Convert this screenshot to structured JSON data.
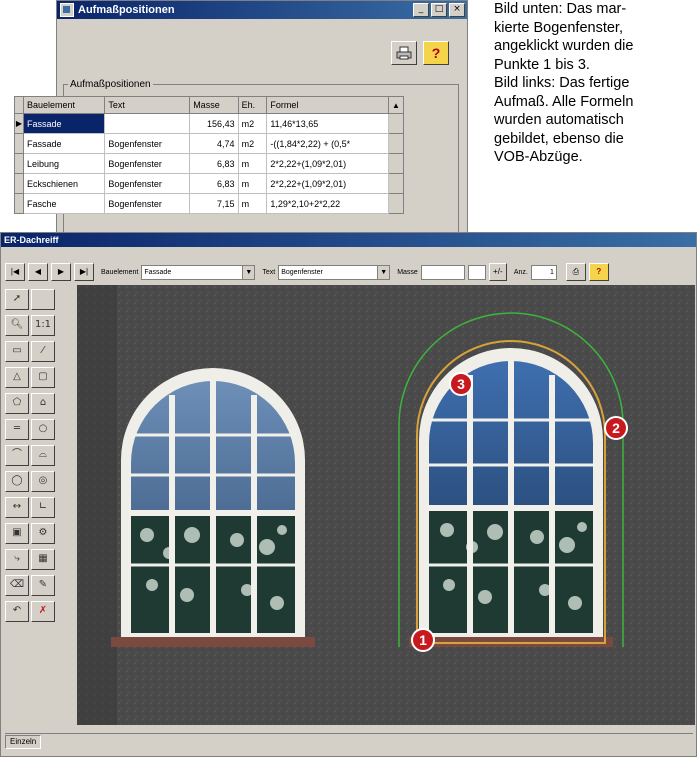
{
  "dialog": {
    "title": "Aufmaßpositionen",
    "controls": {
      "minimize": "_",
      "maximize": "□",
      "close": "×"
    },
    "legend": "Aufmaßpositionen",
    "columns": [
      "Bauelement",
      "Text",
      "Masse",
      "Eh.",
      "Formel"
    ],
    "rows": [
      {
        "indicator": "▶",
        "bauelement": "Fassade",
        "text": "",
        "masse": "156,43",
        "eh": "m2",
        "formel": "11,46*13,65"
      },
      {
        "indicator": "",
        "bauelement": "Fassade",
        "text": "Bogenfenster",
        "masse": "4,74",
        "eh": "m2",
        "formel": "-((1,84*2,22) + (0,5*"
      },
      {
        "indicator": "",
        "bauelement": "Leibung",
        "text": "Bogenfenster",
        "masse": "6,83",
        "eh": "m",
        "formel": "2*2,22+(1,09*2,01)"
      },
      {
        "indicator": "",
        "bauelement": "Eckschienen",
        "text": "Bogenfenster",
        "masse": "6,83",
        "eh": "m",
        "formel": "2*2,22+(1,09*2,01)"
      },
      {
        "indicator": "",
        "bauelement": "Fasche",
        "text": "Bogenfenster",
        "masse": "7,15",
        "eh": "m",
        "formel": "1,29*2,10+2*2,22"
      }
    ]
  },
  "caption": {
    "lines": [
      "Bild unten: Das mar-",
      "kierte Bogenfenster,",
      "angeklickt wurden die",
      "Punkte 1 bis 3.",
      "Bild links: Das fertige",
      "Aufmaß. Alle Formeln",
      "wurden automatisch",
      "gebildet, ebenso die",
      "VOB-Abzüge."
    ]
  },
  "main": {
    "title": "ER-Dachreiff",
    "toolbar": {
      "nav": [
        "|◀",
        "◀",
        "▶",
        "▶|"
      ],
      "bauelement_label": "Bauelement",
      "bauelement_value": "Fassade",
      "text_label": "Text",
      "text_value": "Bogenfenster",
      "masse_label": "Masse",
      "anz_label": "Anz.",
      "anz_value": "1",
      "add_label": "+/-"
    },
    "markers": [
      "1",
      "2",
      "3"
    ],
    "status": "Einzeln"
  },
  "colors": {
    "titlebar": "#0a246a",
    "marker_red": "#c8191e",
    "outline_green": "#3db43d"
  }
}
